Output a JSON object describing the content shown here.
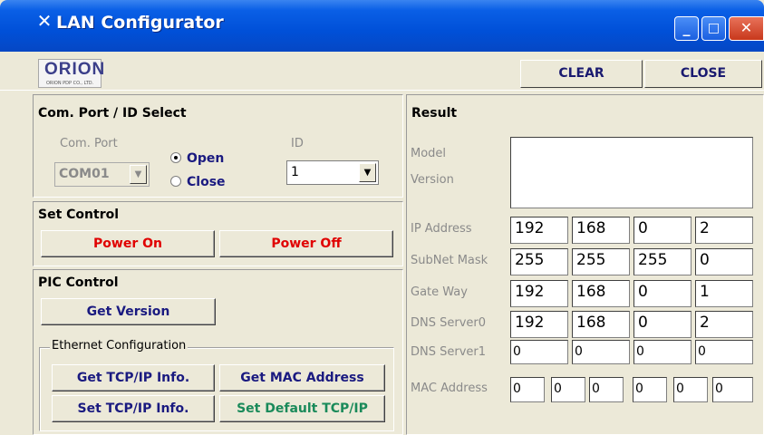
{
  "window": {
    "title": "LAN Configurator",
    "title_icon": "tools-icon",
    "minimize": "_",
    "maximize": "□",
    "close": "✕"
  },
  "toolbar": {
    "logo_text": "ORION",
    "logo_sub": "ORION PDP CO., LTD.",
    "clear_label": "CLEAR",
    "close_label": "CLOSE"
  },
  "comport": {
    "title": "Com. Port / ID Select",
    "port_label": "Com. Port",
    "port_value": "COM01",
    "open_label": "Open",
    "close_label": "Close",
    "selected": "Open",
    "id_label": "ID",
    "id_value": "1"
  },
  "set_control": {
    "title": "Set Control",
    "power_on": "Power On",
    "power_off": "Power Off"
  },
  "pic_control": {
    "title": "PIC Control",
    "get_version": "Get Version",
    "ethernet_label": "Ethernet Configuration",
    "get_tcpip": "Get TCP/IP Info.",
    "get_mac": "Get MAC Address",
    "set_tcpip": "Set TCP/IP Info.",
    "set_default": "Set Default TCP/IP"
  },
  "result": {
    "title": "Result",
    "model_label": "Model",
    "version_label": "Version",
    "rows": [
      {
        "label": "IP Address",
        "values": [
          "192",
          "168",
          "0",
          "2"
        ]
      },
      {
        "label": "SubNet Mask",
        "values": [
          "255",
          "255",
          "255",
          "0"
        ]
      },
      {
        "label": "Gate Way",
        "values": [
          "192",
          "168",
          "0",
          "1"
        ]
      },
      {
        "label": "DNS Server0",
        "values": [
          "192",
          "168",
          "0",
          "2"
        ]
      },
      {
        "label": "DNS Server1",
        "values": [
          "0",
          "0",
          "0",
          "0"
        ]
      }
    ],
    "mac_label": "MAC Address",
    "mac_values": [
      "0",
      "0",
      "0",
      "0",
      "0",
      "0"
    ]
  }
}
